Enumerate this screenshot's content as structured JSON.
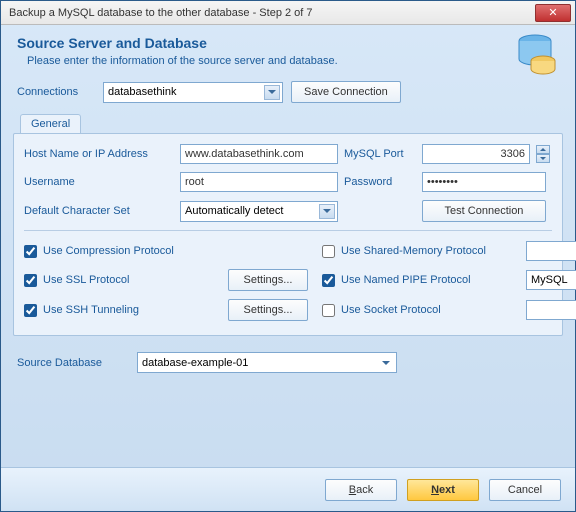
{
  "window": {
    "title": "Backup a MySQL database to the other database - Step 2 of 7"
  },
  "header": {
    "title": "Source Server and Database",
    "subtitle": "Please enter the information of the source server and database."
  },
  "connections": {
    "label": "Connections",
    "selected": "databasethink",
    "save_button": "Save Connection"
  },
  "tabs": {
    "general": "General"
  },
  "form": {
    "host_label": "Host Name or IP Address",
    "host_value": "www.databasethink.com",
    "port_label": "MySQL Port",
    "port_value": "3306",
    "user_label": "Username",
    "user_value": "root",
    "pass_label": "Password",
    "pass_value": "••••••••",
    "charset_label": "Default Character Set",
    "charset_value": "Automatically detect",
    "test_button": "Test Connection"
  },
  "options": {
    "compression": {
      "label": "Use Compression Protocol",
      "checked": true
    },
    "ssl": {
      "label": "Use SSL Protocol",
      "checked": true,
      "settings": "Settings..."
    },
    "ssh": {
      "label": "Use SSH Tunneling",
      "checked": true,
      "settings": "Settings..."
    },
    "shared_mem": {
      "label": "Use Shared-Memory Protocol",
      "checked": false,
      "value": ""
    },
    "named_pipe": {
      "label": "Use Named PIPE Protocol",
      "checked": true,
      "value": "MySQL"
    },
    "socket": {
      "label": "Use Socket Protocol",
      "checked": false,
      "value": ""
    }
  },
  "source_db": {
    "label": "Source Database",
    "selected": "database-example-01"
  },
  "footer": {
    "back": "Back",
    "next": "Next",
    "cancel": "Cancel"
  }
}
